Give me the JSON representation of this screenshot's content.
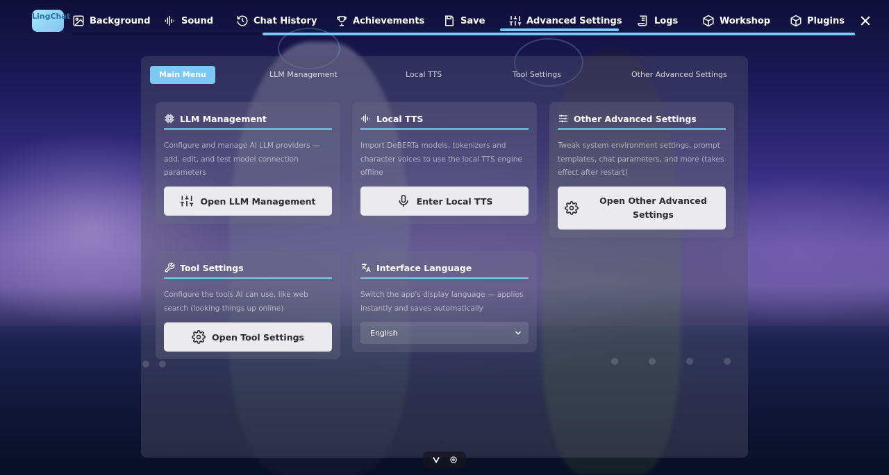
{
  "app": {
    "logo_text": "LingChat"
  },
  "nav": {
    "items": [
      {
        "label": "Background",
        "icon": "image-icon"
      },
      {
        "label": "Sound",
        "icon": "sound-wave-icon"
      },
      {
        "label": "Chat History",
        "icon": "history-icon"
      },
      {
        "label": "Achievements",
        "icon": "trophy-icon"
      },
      {
        "label": "Save",
        "icon": "save-icon"
      },
      {
        "label": "Advanced Settings",
        "icon": "sliders-icon",
        "active": true
      },
      {
        "label": "Logs",
        "icon": "scroll-icon"
      },
      {
        "label": "Workshop",
        "icon": "box-icon"
      },
      {
        "label": "Plugins",
        "icon": "box-icon"
      }
    ],
    "accent_color": "#7ec8f5"
  },
  "subtabs": {
    "items": [
      {
        "label": "Main Menu",
        "active": true
      },
      {
        "label": "LLM Management"
      },
      {
        "label": "Local TTS"
      },
      {
        "label": "Tool Settings"
      },
      {
        "label": "Other Advanced Settings"
      }
    ]
  },
  "cards": {
    "llm": {
      "title": "LLM Management",
      "description": "Configure and manage AI LLM providers — add, edit, and test model connection parameters",
      "button": "Open LLM Management"
    },
    "tts": {
      "title": "Local TTS",
      "description": "Import DeBERTa models, tokenizers and character voices to use the local TTS engine offline",
      "button": "Enter Local TTS"
    },
    "other": {
      "title": "Other Advanced Settings",
      "description": "Tweak system environment settings, prompt templates, chat parameters, and more (takes effect after restart)",
      "button": "Open Other Advanced Settings"
    },
    "tools": {
      "title": "Tool Settings",
      "description": "Configure the tools AI can use, like web search (looking things up online)",
      "button": "Open Tool Settings"
    },
    "language": {
      "title": "Interface Language",
      "description": "Switch the app's display language — applies instantly and saves automatically",
      "selected": "English"
    }
  }
}
